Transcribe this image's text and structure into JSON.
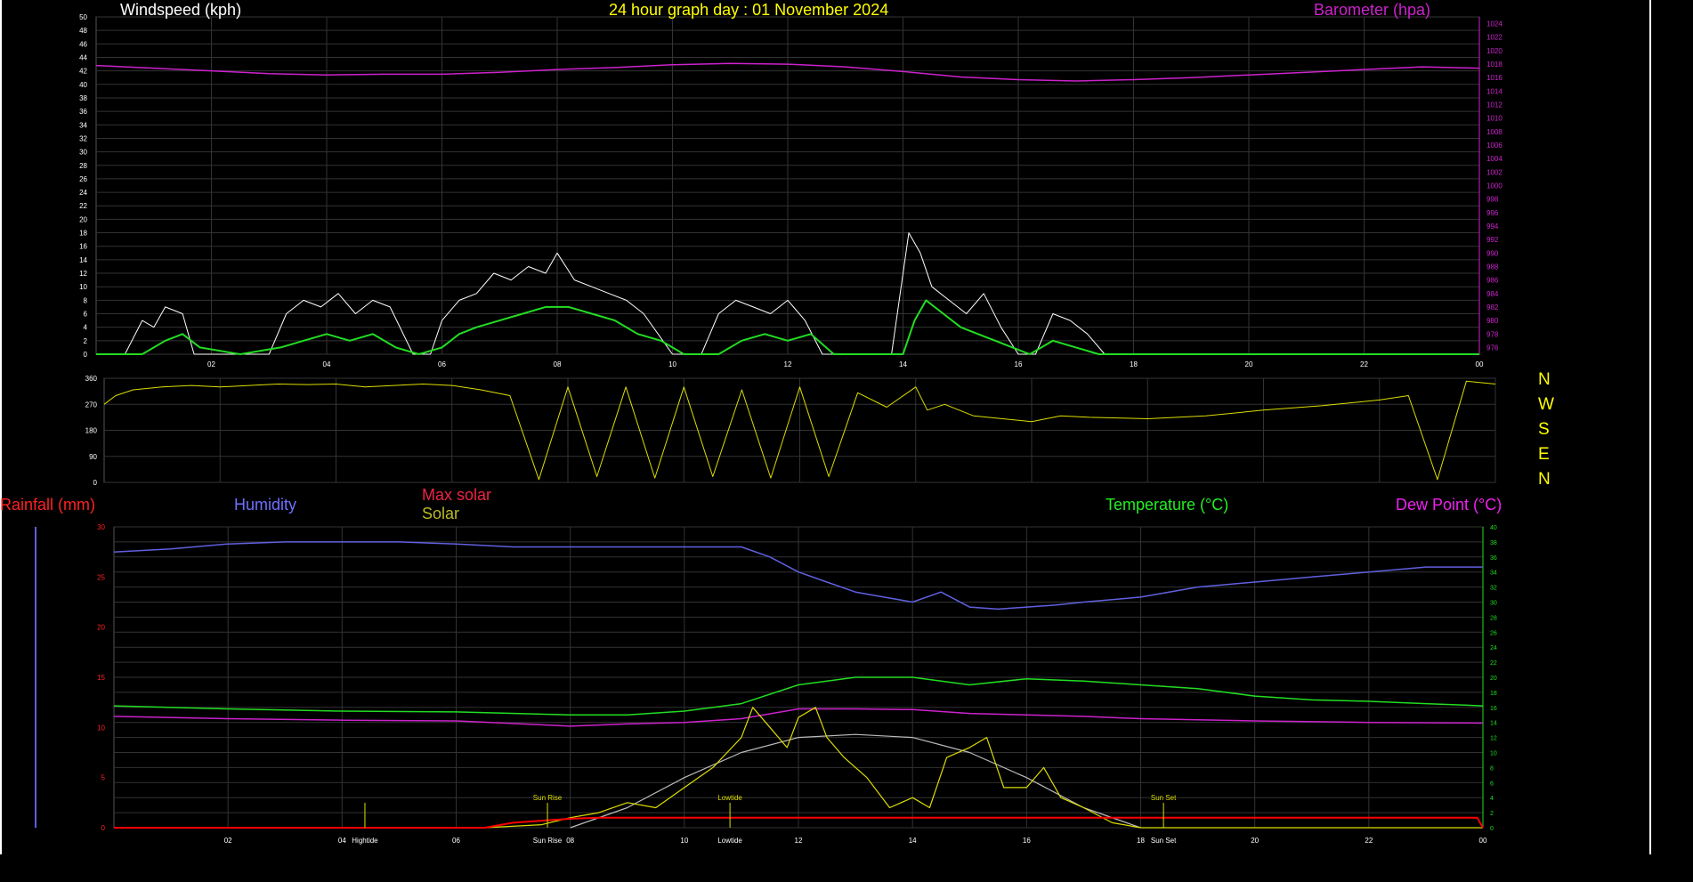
{
  "header": {
    "windspeed_title": "Windspeed (kph)",
    "graph_title": "24 hour graph day : 01 November 2024",
    "barometer_title": "Barometer (hpa)"
  },
  "legend": {
    "rainfall": "Rainfall (mm)",
    "humidity": "Humidity",
    "max_solar": "Max solar",
    "solar": "Solar",
    "temperature": "Temperature (°C)",
    "dew_point": "Dew Point (°C)"
  },
  "compass": [
    "N",
    "W",
    "S",
    "E",
    "N"
  ],
  "colors": {
    "background": "#000000",
    "wind": "#ffffff",
    "wind_avg": "#22dd22",
    "barometer": "#cc22cc",
    "direction": "#dddd00",
    "humidity": "#6060e0",
    "temperature": "#22dd22",
    "dewpoint": "#cc22cc",
    "solar": "#dddd00",
    "max_solar": "#bbbbbb",
    "rain": "#ff0000",
    "title": "#ffff00"
  },
  "markers": {
    "high_tide": "Hightide",
    "low_tide": "Lowtide",
    "sun_rise": "Sun Rise",
    "sun_set": "Sun Set"
  },
  "chart_data": [
    {
      "type": "line",
      "title": "24 hour graph day : 01 November 2024",
      "ylabel": "Windspeed (kph)",
      "y2label": "Barometer (hpa)",
      "ylim": [
        0,
        50
      ],
      "y2lim": [
        975,
        1025
      ],
      "x_ticks": [
        "02",
        "04",
        "06",
        "08",
        "10",
        "12",
        "14",
        "16",
        "18",
        "20",
        "22",
        "00"
      ],
      "y_ticks": [
        0,
        2,
        4,
        6,
        8,
        10,
        12,
        14,
        16,
        18,
        20,
        22,
        24,
        26,
        28,
        30,
        32,
        34,
        36,
        38,
        40,
        42,
        44,
        46,
        48,
        50
      ],
      "y2_ticks": [
        976,
        978,
        980,
        982,
        984,
        986,
        988,
        990,
        992,
        994,
        996,
        998,
        1000,
        1002,
        1004,
        1006,
        1008,
        1010,
        1012,
        1014,
        1016,
        1018,
        1020,
        1022,
        1024
      ],
      "series": [
        {
          "name": "Barometer (hpa)",
          "x": [
            0,
            1,
            2,
            3,
            4,
            5,
            6,
            7,
            8,
            9,
            10,
            11,
            12,
            13,
            14,
            15,
            16,
            17,
            18,
            19,
            20,
            21,
            22,
            23,
            24
          ],
          "values": [
            1017.8,
            1017.4,
            1017.0,
            1016.6,
            1016.4,
            1016.5,
            1016.5,
            1016.8,
            1017.2,
            1017.5,
            1017.9,
            1018.1,
            1018.0,
            1017.6,
            1016.9,
            1016.1,
            1015.7,
            1015.5,
            1015.7,
            1016.0,
            1016.4,
            1016.8,
            1017.2,
            1017.6,
            1017.4
          ]
        },
        {
          "x": [
            0,
            0.5,
            0.8,
            1.0,
            1.2,
            1.5,
            1.7,
            2.0,
            2.5,
            3.0,
            3.3,
            3.6,
            3.9,
            4.2,
            4.5,
            4.8,
            5.1,
            5.5,
            5.8,
            6.0,
            6.3,
            6.6,
            6.9,
            7.2,
            7.5,
            7.8,
            8.0,
            8.3,
            8.6,
            8.9,
            9.2,
            9.5,
            10.0,
            10.5,
            10.8,
            11.1,
            11.4,
            11.7,
            12.0,
            12.3,
            12.6,
            13.0,
            13.5,
            13.8,
            14.1,
            14.3,
            14.5,
            14.8,
            15.1,
            15.4,
            15.7,
            16.0,
            16.3,
            16.6,
            16.9,
            17.2,
            17.5,
            18,
            20,
            22,
            24
          ],
          "values": [
            0,
            0,
            5,
            4,
            7,
            6,
            0,
            0,
            0,
            0,
            6,
            8,
            7,
            9,
            6,
            8,
            7,
            0,
            0,
            5,
            8,
            9,
            12,
            11,
            13,
            12,
            15,
            11,
            10,
            9,
            8,
            6,
            0,
            0,
            6,
            8,
            7,
            6,
            8,
            5,
            0,
            0,
            0,
            0,
            18,
            15,
            10,
            8,
            6,
            9,
            4,
            0,
            0,
            6,
            5,
            3,
            0,
            0,
            0,
            0,
            0
          ]
        },
        {
          "x": [
            0,
            0.8,
            1.2,
            1.5,
            1.8,
            2.5,
            3.2,
            3.6,
            4.0,
            4.4,
            4.8,
            5.2,
            5.6,
            6.0,
            6.3,
            6.6,
            7.0,
            7.4,
            7.8,
            8.2,
            8.6,
            9.0,
            9.4,
            9.8,
            10.2,
            10.8,
            11.2,
            11.6,
            12.0,
            12.4,
            12.8,
            13.2,
            13.6,
            14.0,
            14.2,
            14.4,
            14.7,
            15.0,
            15.3,
            15.6,
            15.9,
            16.2,
            16.6,
            17.0,
            17.4,
            18,
            20,
            22,
            24
          ],
          "values": [
            0,
            0,
            2,
            3,
            1,
            0,
            1,
            2,
            3,
            2,
            3,
            1,
            0,
            1,
            3,
            4,
            5,
            6,
            7,
            7,
            6,
            5,
            3,
            2,
            0,
            0,
            2,
            3,
            2,
            3,
            0,
            0,
            0,
            0,
            5,
            8,
            6,
            4,
            3,
            2,
            1,
            0,
            2,
            1,
            0,
            0,
            0,
            0,
            0
          ]
        }
      ]
    },
    {
      "type": "line",
      "ylim": [
        0,
        360
      ],
      "y_ticks": [
        0,
        90,
        180,
        270,
        360
      ],
      "series": [
        {
          "x": [
            0,
            0.2,
            0.5,
            1.0,
            1.5,
            2.0,
            2.5,
            3.0,
            3.5,
            4.0,
            4.5,
            5.0,
            5.5,
            6.0,
            6.5,
            7.0,
            7.5,
            8.0,
            8.5,
            9.0,
            9.5,
            10.0,
            10.5,
            11.0,
            11.5,
            12.0,
            12.5,
            13.0,
            13.5,
            14.0,
            14.2,
            14.5,
            15.0,
            15.5,
            16.0,
            16.5,
            17.0,
            18.0,
            19.0,
            20.0,
            21.0,
            22.0,
            22.5,
            23.0,
            23.5,
            24.0
          ],
          "values": [
            270,
            300,
            320,
            330,
            335,
            330,
            335,
            340,
            338,
            340,
            330,
            335,
            340,
            335,
            320,
            300,
            10,
            330,
            20,
            330,
            15,
            330,
            20,
            320,
            15,
            330,
            20,
            310,
            260,
            330,
            250,
            270,
            230,
            220,
            210,
            230,
            225,
            220,
            230,
            250,
            265,
            285,
            300,
            10,
            350,
            340
          ]
        }
      ]
    },
    {
      "type": "line",
      "y_ticks_left": [
        0,
        5,
        10,
        15,
        20,
        25,
        30
      ],
      "y_ticks_right": [
        0,
        2,
        4,
        6,
        8,
        10,
        12,
        14,
        16,
        18,
        20,
        22,
        24,
        26,
        28,
        30,
        32,
        34,
        36,
        38,
        40
      ],
      "ylim": [
        0,
        30
      ],
      "y2lim": [
        0,
        40
      ],
      "x_ticks": [
        "02",
        "04",
        "06",
        "08",
        "10",
        "12",
        "14",
        "16",
        "18",
        "20",
        "22",
        "00"
      ],
      "series": [
        {
          "name": "Humidity",
          "x": [
            0,
            1,
            2,
            3,
            4,
            5,
            6,
            7,
            8,
            9,
            10,
            11,
            11.5,
            12,
            12.5,
            13,
            13.5,
            14,
            14.5,
            15,
            15.5,
            16,
            16.5,
            17,
            18,
            19,
            20,
            21,
            22,
            23,
            24
          ],
          "values": [
            27.5,
            27.8,
            28.3,
            28.5,
            28.5,
            28.5,
            28.3,
            28.0,
            28.0,
            28.0,
            28.0,
            28.0,
            27.0,
            25.5,
            24.5,
            23.5,
            23.0,
            22.5,
            23.5,
            22.0,
            21.8,
            22.0,
            22.2,
            22.5,
            23.0,
            24.0,
            24.5,
            25.0,
            25.5,
            26.0,
            26.0
          ]
        },
        {
          "name": "Temperature (°C)",
          "x": [
            0,
            2,
            4,
            6,
            8,
            9,
            10,
            11,
            12,
            13,
            14,
            15,
            16,
            17,
            18,
            19,
            20,
            21,
            22,
            23,
            24
          ],
          "values": [
            16.2,
            15.8,
            15.5,
            15.4,
            15.0,
            15.0,
            15.5,
            16.5,
            19.0,
            20.0,
            20.0,
            19.0,
            19.8,
            19.5,
            19.0,
            18.5,
            17.5,
            17.0,
            16.8,
            16.5,
            16.2
          ]
        },
        {
          "name": "Dew Point (°C)",
          "x": [
            0,
            2,
            4,
            6,
            8,
            9,
            10,
            11,
            12,
            13,
            14,
            15,
            16,
            17,
            18,
            20,
            22,
            24
          ],
          "values": [
            14.8,
            14.5,
            14.3,
            14.2,
            13.5,
            13.8,
            14.0,
            14.5,
            15.8,
            15.8,
            15.7,
            15.2,
            15.0,
            14.8,
            14.5,
            14.2,
            14.0,
            13.9
          ]
        },
        {
          "name": "Max solar",
          "x": [
            8,
            9,
            10,
            11,
            12,
            13,
            14,
            15,
            16,
            17,
            18
          ],
          "values": [
            0,
            2,
            5,
            7.5,
            9,
            9.3,
            9,
            7.5,
            5,
            2,
            0
          ]
        },
        {
          "name": "Solar",
          "x": [
            0,
            6.5,
            7.5,
            8.0,
            8.5,
            9.0,
            9.5,
            10.0,
            10.5,
            11.0,
            11.2,
            11.5,
            11.8,
            12.0,
            12.3,
            12.5,
            12.8,
            13.2,
            13.6,
            14.0,
            14.3,
            14.6,
            15.0,
            15.3,
            15.6,
            16.0,
            16.3,
            16.6,
            17.0,
            17.5,
            18.0,
            24
          ],
          "values": [
            0,
            0,
            0.3,
            1,
            1.5,
            2.5,
            2,
            4,
            6,
            9,
            12,
            10,
            8,
            11,
            12,
            9,
            7,
            5,
            2,
            3,
            2,
            7,
            8,
            9,
            4,
            4,
            6,
            3,
            2,
            0.5,
            0,
            0
          ]
        },
        {
          "name": "Rainfall (mm)",
          "x": [
            0,
            6.5,
            7.0,
            7.5,
            8.0,
            8.5,
            9.0,
            23.9,
            24
          ],
          "values": [
            0,
            0,
            0.5,
            0.7,
            0.9,
            1.0,
            1.0,
            1.0,
            0
          ]
        }
      ]
    }
  ]
}
